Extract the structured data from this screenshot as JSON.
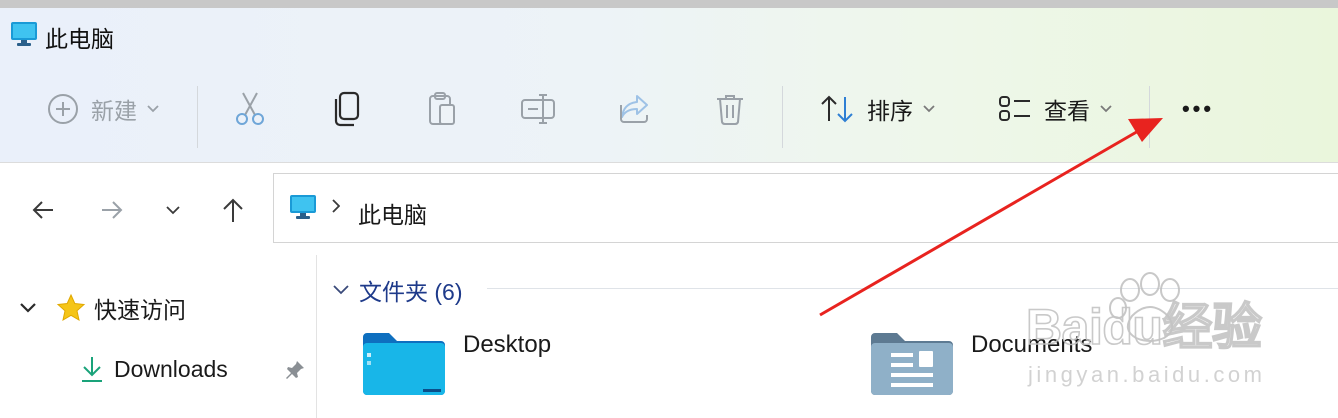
{
  "window": {
    "title": "此电脑"
  },
  "toolbar": {
    "new_label": "新建",
    "sort_label": "排序",
    "view_label": "查看",
    "more_label": "•••",
    "icons": [
      "plus-circle-icon",
      "cut-icon",
      "copy-icon",
      "paste-icon",
      "rename-icon",
      "share-icon",
      "delete-icon",
      "sort-icon",
      "view-icon",
      "more-icon"
    ]
  },
  "addressbar": {
    "path": "此电脑"
  },
  "sidebar": {
    "quick_access_label": "快速访问",
    "items": [
      {
        "label": "Downloads"
      }
    ]
  },
  "content": {
    "group_label": "文件夹 (6)",
    "items": [
      {
        "name": "Desktop"
      },
      {
        "name": "Documents"
      }
    ]
  },
  "watermark": {
    "brand": "Baidu经验",
    "url": "jingyan.baidu.com"
  },
  "colors": {
    "accent": "#2e7fd4",
    "annotation_arrow": "#e8231f",
    "group_header": "#1e3a8a"
  }
}
